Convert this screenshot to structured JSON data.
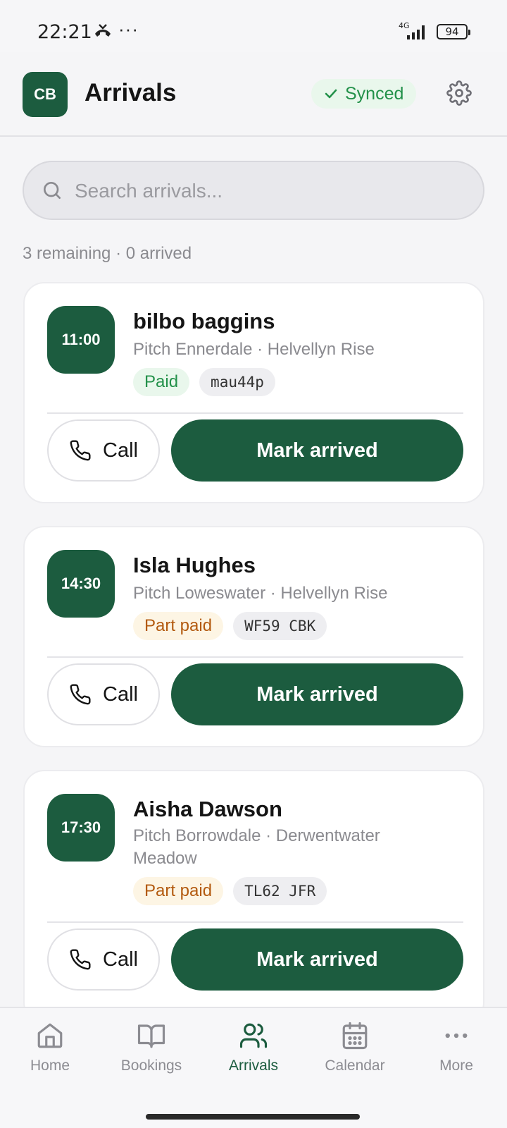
{
  "status_bar": {
    "time": "22:21",
    "dots": "···",
    "network": "4G",
    "battery": "94"
  },
  "header": {
    "avatar_initials": "CB",
    "title": "Arrivals",
    "sync_status": "Synced"
  },
  "search": {
    "placeholder": "Search arrivals..."
  },
  "summary": "3 remaining · 0 arrived",
  "arrivals": [
    {
      "time": "11:00",
      "name": "bilbo baggins",
      "pitch": "Pitch Ennerdale · Helvellyn Rise",
      "payment": "Paid",
      "reference": "mau44p",
      "call_label": "Call",
      "action_label": "Mark arrived"
    },
    {
      "time": "14:30",
      "name": "Isla Hughes",
      "pitch": "Pitch Loweswater · Helvellyn Rise",
      "payment": "Part paid",
      "reference": "WF59 CBK",
      "call_label": "Call",
      "action_label": "Mark arrived"
    },
    {
      "time": "17:30",
      "name": "Aisha Dawson",
      "pitch": "Pitch Borrowdale · Derwentwater Meadow",
      "payment": "Part paid",
      "reference": "TL62 JFR",
      "call_label": "Call",
      "action_label": "Mark arrived"
    }
  ],
  "nav": [
    {
      "label": "Home",
      "icon": "home-icon"
    },
    {
      "label": "Bookings",
      "icon": "book-icon"
    },
    {
      "label": "Arrivals",
      "icon": "users-icon",
      "active": true
    },
    {
      "label": "Calendar",
      "icon": "calendar-icon"
    },
    {
      "label": "More",
      "icon": "more-icon"
    }
  ],
  "colors": {
    "brand": "#1c5c3f",
    "success": "#23914a",
    "warning": "#b35a0f"
  }
}
